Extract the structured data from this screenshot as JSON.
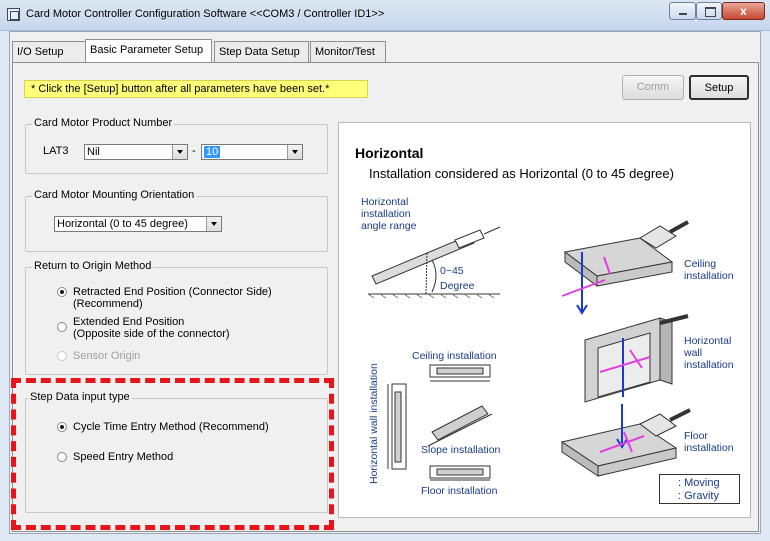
{
  "window": {
    "title": "Card Motor Controller Configuration Software <<COM3 / Controller ID1>>",
    "close_glyph": "x"
  },
  "tabs": [
    {
      "label": "I/O Setup"
    },
    {
      "label": "Basic Parameter Setup"
    },
    {
      "label": "Step Data Setup"
    },
    {
      "label": "Monitor/Test"
    }
  ],
  "notice": "* Click the [Setup] button after all parameters have been set.*",
  "buttons": {
    "comm": "Comm",
    "setup": "Setup"
  },
  "product_number": {
    "title": "Card Motor Product Number",
    "prefix": "LAT3",
    "model_value": "Nil",
    "separator": "-",
    "stroke_value": "10"
  },
  "mounting": {
    "title": "Card Motor Mounting Orientation",
    "value": "Horizontal (0 to 45 degree)"
  },
  "origin": {
    "title": "Return to Origin Method",
    "options": [
      {
        "label_line1": "Retracted End Position (Connector Side)",
        "label_line2": "(Recommend)"
      },
      {
        "label_line1": "Extended End Position",
        "label_line2": "(Opposite side of the connector)"
      },
      {
        "label_line1": "Sensor Origin",
        "label_line2": ""
      }
    ]
  },
  "step_input": {
    "title": "Step Data input type",
    "options": [
      {
        "label": "Cycle Time Entry Method (Recommend)"
      },
      {
        "label": "Speed Entry Method"
      }
    ]
  },
  "illustration": {
    "title": "Horizontal",
    "subtitle": "Installation considered as Horizontal (0 to 45 degree)",
    "range_label_1": "Horizontal",
    "range_label_2": "installation",
    "range_label_3": "angle range",
    "angle_1": "0~45",
    "angle_2": "Degree",
    "ceiling_label": "Ceiling installation",
    "slope_label": "Slope installation",
    "floor_label": "Floor installation",
    "wall_vertical_label": "Horizontal wall installation",
    "ceiling_right_1": "Ceiling",
    "ceiling_right_2": "installation",
    "wall_right_1": "Horizontal",
    "wall_right_2": "wall",
    "wall_right_3": "installation",
    "floor_right_1": "Floor",
    "floor_right_2": "installation",
    "legend_moving": ": Moving",
    "legend_gravity": ": Gravity"
  },
  "colors": {
    "notice_bg": "#ffff7a",
    "highlight_dash": "#e8141c",
    "moving_arrow": "#e040e0",
    "gravity_arrow": "#1a3ad0"
  }
}
